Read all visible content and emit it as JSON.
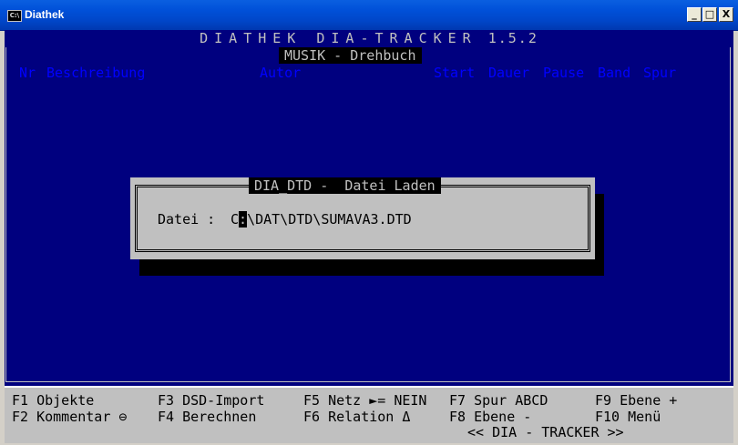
{
  "window": {
    "title": "Diathek",
    "icon_label": "C:\\",
    "buttons": [
      "_",
      "□",
      "X"
    ]
  },
  "header": {
    "app_name": "DIATHEK DIA-TRACKER",
    "version": "1.5.2",
    "mode": "MUSIK - Drehbuch"
  },
  "table": {
    "columns": [
      "Nr",
      "Beschreibung",
      "Autor",
      "Start",
      "Dauer",
      "Pause",
      "Band",
      "Spur"
    ]
  },
  "dialog": {
    "title": "DIA_DTD -  Datei Laden",
    "field_label": "Datei :",
    "value_before_cursor": "C",
    "cursor_char": ":",
    "value_after_cursor": "\\DAT\\DTD\\SUMAVA3.DTD"
  },
  "function_keys": [
    {
      "key": "F1",
      "label": "Objekte"
    },
    {
      "key": "F2",
      "label": "Kommentar ⊖"
    },
    {
      "key": "F3",
      "label": "DSD-Import"
    },
    {
      "key": "F4",
      "label": "Berechnen"
    },
    {
      "key": "F5",
      "label": "Netz ►= NEIN"
    },
    {
      "key": "F6",
      "label": "Relation Δ"
    },
    {
      "key": "F7",
      "label": "Spur ABCD"
    },
    {
      "key": "F8",
      "label": "Ebene -"
    },
    {
      "key": "F9",
      "label": "Ebene +"
    },
    {
      "key": "F10",
      "label": "Menü"
    }
  ],
  "footer": "<< DIA - TRACKER >>",
  "colors": {
    "console_bg": "#00007f",
    "text_gray": "#c0c0c0",
    "column_blue": "#0000ff",
    "titlebar_blue": "#0050d8"
  }
}
